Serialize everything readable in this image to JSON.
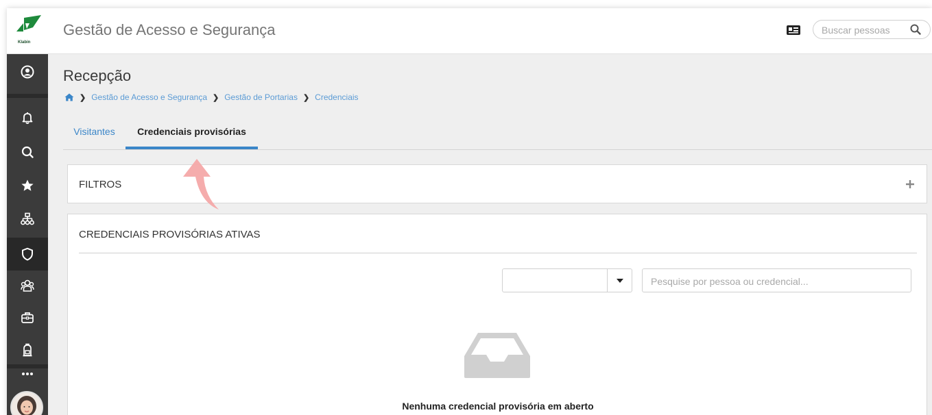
{
  "app": {
    "logo_text": "Klabin",
    "title": "Gestão de Acesso e Segurança",
    "search_placeholder": "Buscar pessoas"
  },
  "sidebar": {
    "items": [
      {
        "icon": "user-circle-icon"
      },
      {
        "icon": "bell-icon"
      },
      {
        "icon": "search-icon"
      },
      {
        "icon": "star-icon"
      },
      {
        "icon": "sitemap-icon"
      },
      {
        "icon": "shield-icon",
        "active": true
      },
      {
        "icon": "users-icon"
      },
      {
        "icon": "briefcase-icon"
      },
      {
        "icon": "backpack-icon"
      },
      {
        "icon": "more-icon"
      }
    ]
  },
  "page": {
    "title": "Recepção",
    "breadcrumb": [
      "Gestão de Acesso e Segurança",
      "Gestão de Portarias",
      "Credenciais"
    ]
  },
  "tabs": [
    {
      "label": "Visitantes",
      "active": false
    },
    {
      "label": "Credenciais provisórias",
      "active": true
    }
  ],
  "filters": {
    "title": "FILTROS"
  },
  "active_credentials": {
    "title": "CREDENCIAIS PROVISÓRIAS ATIVAS",
    "select_value": "",
    "search_placeholder": "Pesquise por pessoa ou credencial...",
    "empty_message": "Nenhuma credencial provisória em aberto"
  },
  "colors": {
    "accent": "#3b86c8",
    "sidebar": "#3b3b3b",
    "brand_green": "#1e8a3c"
  }
}
